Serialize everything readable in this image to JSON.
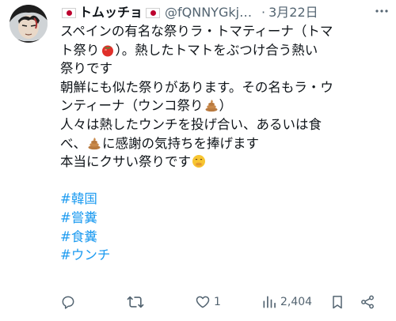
{
  "post": {
    "display_name": "トムッチョ",
    "handle": "@fQNNYGkjh...",
    "separator": "·",
    "date": "3月22日",
    "lines": [
      "スペインの有名な祭りラ・トマティーナ（トマ",
      "ト祭り",
      "）。熱したトマトをぶつけ合う熱い",
      "祭りです",
      "朝鮮にも似た祭りがあります。その名もラ・ウ",
      "ンティーナ（ウンコ祭り",
      "）",
      "人々は熱したウンチを投げ合い、あるいは食",
      "べ、",
      "に感謝の気持ちを捧げます",
      "本当にクサい祭りです"
    ],
    "hashtags": [
      "#韓国",
      "#嘗糞",
      "#食糞",
      "#ウンチ"
    ]
  },
  "actions": {
    "reply_count": "",
    "repost_count": "",
    "like_count": "1",
    "views_count": "2,404"
  },
  "icons": {
    "flag": "japan-flag-icon",
    "tomato": "tomato-emoji-icon",
    "poop": "poop-emoji-icon",
    "face": "hand-over-mouth-emoji-icon",
    "more": "more-dots-icon",
    "reply": "reply-icon",
    "repost": "repost-icon",
    "like": "heart-icon",
    "views": "views-icon",
    "bookmark": "bookmark-icon",
    "share": "share-icon"
  },
  "colors": {
    "text": "#0f1419",
    "secondary": "#536471",
    "hashtag": "#1d9bf0",
    "flag_red": "#bc002d"
  }
}
